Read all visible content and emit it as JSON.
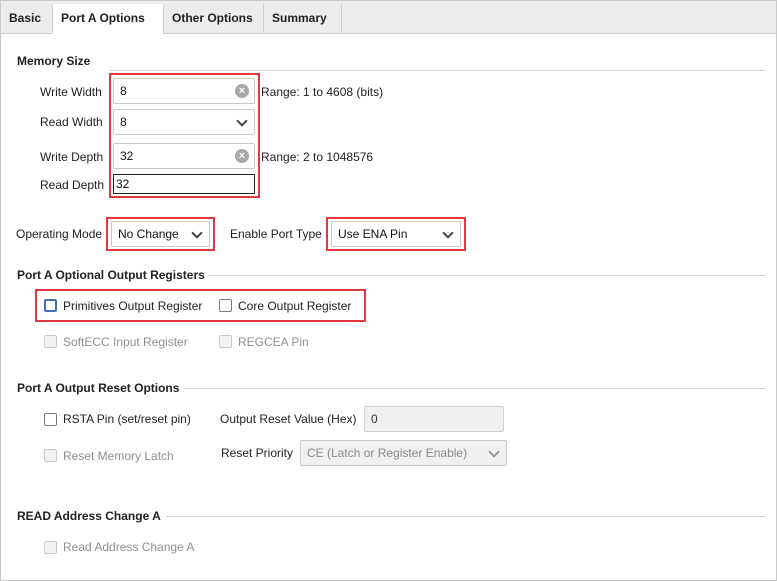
{
  "tabs": [
    "Basic",
    "Port A Options",
    "Other Options",
    "Summary"
  ],
  "active_tab": "Port A Options",
  "memory_size": {
    "title": "Memory Size",
    "write_width": {
      "label": "Write Width",
      "value": "8",
      "range": "Range: 1 to 4608 (bits)"
    },
    "read_width": {
      "label": "Read Width",
      "value": "8"
    },
    "write_depth": {
      "label": "Write Depth",
      "value": "32",
      "range": "Range: 2 to 1048576"
    },
    "read_depth": {
      "label": "Read Depth",
      "value": "32"
    }
  },
  "modes": {
    "operating_mode": {
      "label": "Operating Mode",
      "value": "No Change"
    },
    "enable_port_type": {
      "label": "Enable Port Type",
      "value": "Use ENA Pin"
    }
  },
  "optional_output_registers": {
    "title": "Port A Optional Output Registers",
    "primitives": {
      "label": "Primitives Output Register",
      "checked": false
    },
    "core": {
      "label": "Core Output Register",
      "checked": false
    },
    "softecc": {
      "label": "SoftECC Input Register",
      "enabled": false
    },
    "regcea": {
      "label": "REGCEA Pin",
      "enabled": false
    }
  },
  "output_reset": {
    "title": "Port A Output Reset Options",
    "rsta": {
      "label": "RSTA Pin (set/reset pin)",
      "checked": false
    },
    "reset_value": {
      "label": "Output Reset Value (Hex)",
      "value": "0"
    },
    "reset_memory_latch": {
      "label": "Reset Memory Latch",
      "enabled": false
    },
    "reset_priority": {
      "label": "Reset Priority",
      "value": "CE (Latch or Register Enable)"
    }
  },
  "read_address_change": {
    "title": "READ Address Change A",
    "checkbox": {
      "label": "Read Address Change A",
      "enabled": false
    }
  },
  "colors": {
    "highlight": "#e0383e",
    "focus": "#3e6fb6"
  }
}
